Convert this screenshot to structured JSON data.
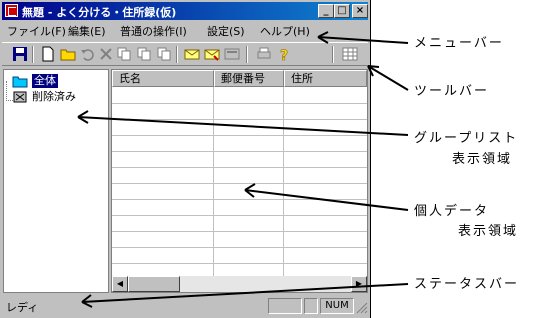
{
  "window": {
    "title": "無題 - よく分ける・住所録(仮)",
    "min_glyph": "_",
    "max_glyph": "□",
    "close_glyph": "×"
  },
  "menu": [
    "ファイル(F)",
    "編集(E)",
    "普通の操作(I)",
    "設定(S)",
    "ヘルプ(H)"
  ],
  "tree": {
    "items": [
      {
        "label": "全体",
        "selected": true
      },
      {
        "label": "削除済み",
        "selected": false
      }
    ]
  },
  "list": {
    "columns": [
      "氏名",
      "郵便番号",
      "住所"
    ]
  },
  "status": {
    "text": "レディ",
    "num": "NUM"
  },
  "annotations": {
    "menubar": "メニューバー",
    "toolbar": "ツールバー",
    "grouplist_1": "グループリスト",
    "grouplist_2": "表示領域",
    "personal_1": "個人データ",
    "personal_2": "表示領域",
    "statusbar": "ステータスバー"
  },
  "colors": {
    "titlebar": "#00008b",
    "selection": "#000080",
    "chrome": "#c0c0c0"
  }
}
